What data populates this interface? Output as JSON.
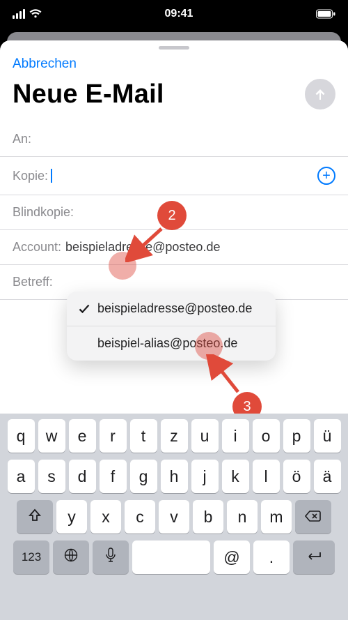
{
  "statusbar": {
    "time": "09:41"
  },
  "sheet": {
    "cancel": "Abbrechen",
    "title": "Neue E-Mail",
    "fields": {
      "to_label": "An:",
      "cc_label": "Kopie:",
      "bcc_label": "Blindkopie:",
      "account_label": "Account:",
      "subject_label": "Betreff:"
    },
    "account_value": "beispieladresse@posteo.de",
    "account_menu": {
      "option0": "beispieladresse@posteo.de",
      "option1": "beispiel-alias@posteo.de"
    }
  },
  "annotations": {
    "step2": "2",
    "step3": "3"
  },
  "keyboard": {
    "row1": [
      "q",
      "w",
      "e",
      "r",
      "t",
      "z",
      "u",
      "i",
      "o",
      "p",
      "ü"
    ],
    "row2": [
      "a",
      "s",
      "d",
      "f",
      "g",
      "h",
      "j",
      "k",
      "l",
      "ö",
      "ä"
    ],
    "row3": [
      "y",
      "x",
      "c",
      "v",
      "b",
      "n",
      "m"
    ],
    "row4_123": "123",
    "row4_at": "@",
    "row4_dot": "."
  }
}
